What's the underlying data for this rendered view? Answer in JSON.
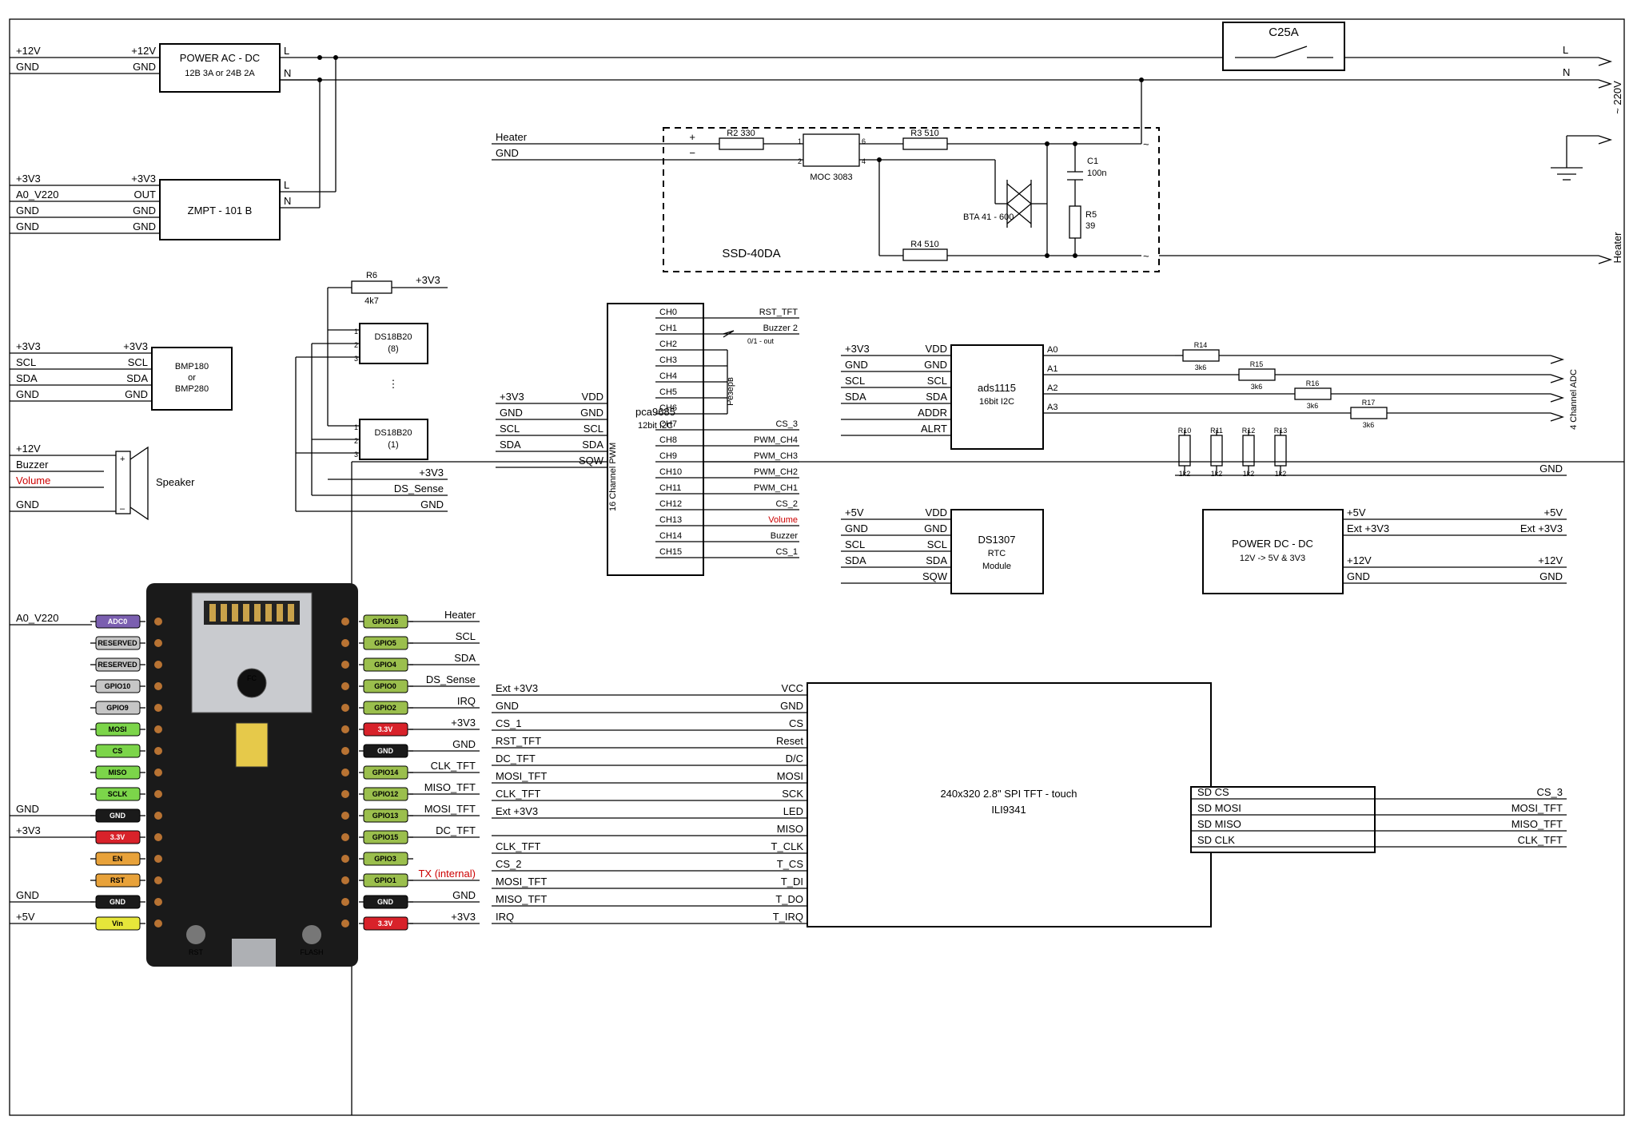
{
  "mains": {
    "L": "L",
    "N": "N",
    "label": "~ 220V",
    "heater": "Heater"
  },
  "relay": {
    "name": "C25A"
  },
  "psu_acdc": {
    "name": "POWER  AC - DC",
    "sub": "12B 3A or 24B 2A",
    "L": "L",
    "N": "N"
  },
  "bus1": {
    "p12": "+12V",
    "gnd": "GND"
  },
  "zmpt": {
    "name": "ZMPT - 101 B",
    "p3v3": "+3V3",
    "out": "OUT",
    "gnd": "GND",
    "L": "L",
    "N": "N",
    "a0": "A0_V220"
  },
  "bus2": {
    "p3v3": "+3V3",
    "a0": "A0_V220",
    "gnd": "GND",
    "gnd2": "GND"
  },
  "bmp": {
    "name": "BMP180\nor\nBMP280",
    "p3v3": "+3V3",
    "scl": "SCL",
    "sda": "SDA",
    "gnd": "GND"
  },
  "bus3": {
    "p3v3": "+3V3",
    "scl": "SCL",
    "sda": "SDA",
    "gnd": "GND"
  },
  "speaker": {
    "name": "Speaker",
    "p12": "+12V",
    "buzzer": "Buzzer",
    "volume": "Volume",
    "gnd": "GND"
  },
  "ds18": {
    "name1": "DS18B20\n(8)",
    "name2": "DS18B20\n(1)",
    "r": "R6",
    "rv": "4k7",
    "p3v3": "+3V3",
    "ds": "DS_Sense",
    "gnd": "GND"
  },
  "ssr": {
    "block": "SSD-40DA",
    "heater": "Heater",
    "gnd": "GND",
    "moc": "MOC 3083",
    "triac": "BTA 41 - 600",
    "r2": "R2  330",
    "r3": "R3  510",
    "r4": "R4  510",
    "r5n": "R5",
    "r5v": "39",
    "c1n": "C1",
    "c1v": "100n"
  },
  "pca": {
    "name": "pca9685",
    "sub": "12bit I2C",
    "side": "16 Channel PWM",
    "left": {
      "p3v3": "+3V3",
      "gnd": "GND",
      "scl": "SCL",
      "sda": "SDA",
      "vdd": "VDD",
      "gnd2": "GND",
      "scl2": "SCL",
      "sda2": "SDA",
      "sqw": "SQW"
    },
    "ch": [
      "CH0",
      "CH1",
      "CH2",
      "CH3",
      "CH4",
      "CH5",
      "CH6",
      "CH7",
      "CH8",
      "CH9",
      "CH10",
      "CH11",
      "CH12",
      "CH13",
      "CH14",
      "CH15"
    ],
    "rlabel": "Резерв",
    "out": {
      "rst": "RST_TFT",
      "buz2": "Buzzer 2",
      "buz2b": "0/1 - out",
      "cs3": "CS_3",
      "p4": "PWM_CH4",
      "p3": "PWM_CH3",
      "p2": "PWM_CH2",
      "p1": "PWM_CH1",
      "cs2": "CS_2",
      "vol": "Volume",
      "buz": "Buzzer",
      "cs1": "CS_1"
    }
  },
  "ads": {
    "name": "ads1115",
    "sub": "16bit I2C",
    "left": {
      "p3v3": "+3V3",
      "gnd": "GND",
      "scl": "SCL",
      "sda": "SDA",
      "vdd": "VDD",
      "gnd2": "GND",
      "scl2": "SCL",
      "sda2": "SDA",
      "addr": "ADDR",
      "alrt": "ALRT"
    },
    "a": [
      "A0",
      "A1",
      "A2",
      "A3"
    ],
    "r_top": [
      "R14",
      "R15",
      "R16",
      "R17"
    ],
    "r_topv": "3k6",
    "r_bot": [
      "R10",
      "R11",
      "R12",
      "R13"
    ],
    "r_botv": "1k2",
    "out": "4 Channel ADC",
    "gndout": "GND"
  },
  "rtc": {
    "name": "DS1307",
    "sub": "RTC",
    "sub2": "Module",
    "left": {
      "p5": "+5V",
      "gnd": "GND",
      "scl": "SCL",
      "sda": "SDA",
      "vdd": "VDD",
      "gnd2": "GND",
      "scl2": "SCL",
      "sda2": "SDA",
      "sqw": "SQW"
    }
  },
  "dcdc": {
    "name": "POWER  DC - DC",
    "sub": "12V -> 5V & 3V3",
    "right": {
      "p5": "+5V",
      "ext": "Ext +3V3",
      "p12": "+12V",
      "gnd": "GND"
    }
  },
  "tft": {
    "name": "240x320 2.8\" SPI TFT - touch",
    "chip": "ILI9341",
    "pins": [
      [
        "Ext +3V3",
        "VCC"
      ],
      [
        "GND",
        "GND"
      ],
      [
        "CS_1",
        "CS"
      ],
      [
        "RST_TFT",
        "Reset"
      ],
      [
        "DC_TFT",
        "D/C"
      ],
      [
        "MOSI_TFT",
        "MOSI"
      ],
      [
        "CLK_TFT",
        "SCK"
      ],
      [
        "Ext +3V3",
        "LED"
      ],
      [
        "",
        "MISO"
      ],
      [
        "CLK_TFT",
        "T_CLK"
      ],
      [
        "CS_2",
        "T_CS"
      ],
      [
        "MOSI_TFT",
        "T_DI"
      ],
      [
        "MISO_TFT",
        "T_DO"
      ],
      [
        "IRQ",
        "T_IRQ"
      ]
    ]
  },
  "sd": {
    "pins": [
      [
        "SD  CS",
        "CS_3"
      ],
      [
        "SD  MOSI",
        "MOSI_TFT"
      ],
      [
        "SD  MISO",
        "MISO_TFT"
      ],
      [
        "SD  CLK",
        "CLK_TFT"
      ]
    ]
  },
  "mcu": {
    "a0": "A0_V220",
    "left_bus": [
      "",
      "",
      "",
      "",
      "",
      "",
      "",
      "",
      "",
      "GND",
      "+3V3",
      "",
      "",
      "GND",
      "+5V"
    ],
    "right_bus": [
      "Heater",
      "SCL",
      "SDA",
      "DS_Sense",
      "IRQ",
      "+3V3",
      "GND",
      "CLK_TFT",
      "MISO_TFT",
      "MOSI_TFT",
      "DC_TFT",
      "",
      "TX (internal)",
      "GND",
      "+3V3"
    ],
    "left_badge": [
      [
        "ADC0",
        "#7b5fb0",
        "#fff"
      ],
      [
        "RESERVED",
        "#c6c6c6",
        "#000"
      ],
      [
        "RESERVED",
        "#c6c6c6",
        "#000"
      ],
      [
        "GPIO10",
        "#c6c6c6",
        "#000"
      ],
      [
        "GPIO9",
        "#c6c6c6",
        "#000"
      ],
      [
        "MOSI",
        "#7cd54a",
        "#000"
      ],
      [
        "CS",
        "#7cd54a",
        "#000"
      ],
      [
        "MISO",
        "#7cd54a",
        "#000"
      ],
      [
        "SCLK",
        "#7cd54a",
        "#000"
      ],
      [
        "GND",
        "#1a1a1a",
        "#fff"
      ],
      [
        "3.3V",
        "#d8222a",
        "#fff"
      ],
      [
        "EN",
        "#e8a23a",
        "#000"
      ],
      [
        "RST",
        "#e8a23a",
        "#000"
      ],
      [
        "GND",
        "#1a1a1a",
        "#fff"
      ],
      [
        "Vin",
        "#e6e63a",
        "#000"
      ]
    ],
    "right_badge": [
      [
        "GPIO16",
        "#9bbf4d",
        "#000"
      ],
      [
        "GPIO5",
        "#9bbf4d",
        "#000"
      ],
      [
        "GPIO4",
        "#9bbf4d",
        "#000"
      ],
      [
        "GPIO0",
        "#9bbf4d",
        "#000"
      ],
      [
        "GPIO2",
        "#9bbf4d",
        "#000"
      ],
      [
        "3.3V",
        "#d8222a",
        "#fff"
      ],
      [
        "GND",
        "#1a1a1a",
        "#fff"
      ],
      [
        "GPIO14",
        "#9bbf4d",
        "#000"
      ],
      [
        "GPIO12",
        "#9bbf4d",
        "#000"
      ],
      [
        "GPIO13",
        "#9bbf4d",
        "#000"
      ],
      [
        "GPIO15",
        "#9bbf4d",
        "#000"
      ],
      [
        "GPIO3",
        "#9bbf4d",
        "#000"
      ],
      [
        "GPIO1",
        "#9bbf4d",
        "#000"
      ],
      [
        "GND",
        "#1a1a1a",
        "#fff"
      ],
      [
        "3.3V",
        "#d8222a",
        "#fff"
      ]
    ],
    "btn1": "RST",
    "btn2": "FLASH"
  }
}
